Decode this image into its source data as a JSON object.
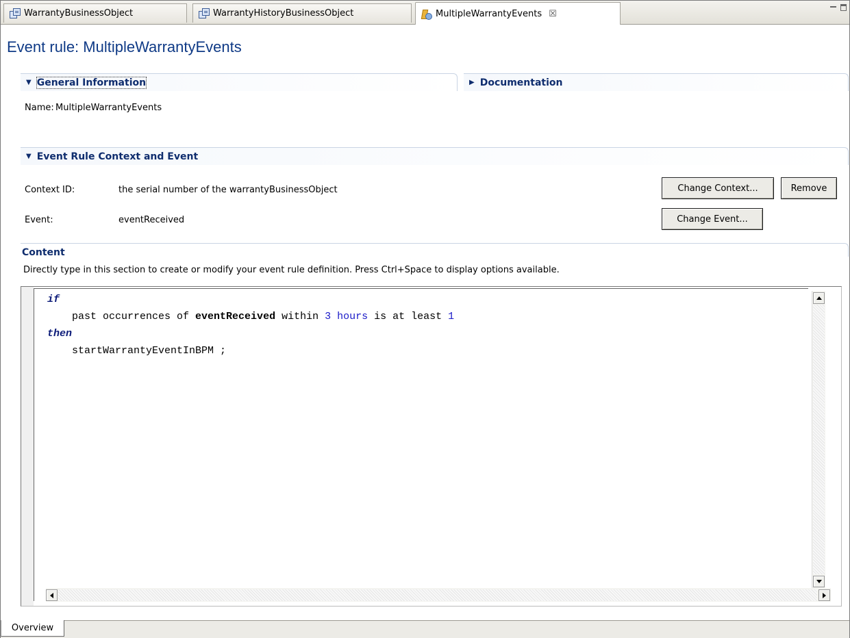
{
  "tabs": [
    {
      "label": "WarrantyBusinessObject",
      "icon": "business-object-icon"
    },
    {
      "label": "WarrantyHistoryBusinessObject",
      "icon": "business-object-icon"
    },
    {
      "label": "MultipleWarrantyEvents",
      "icon": "event-rule-icon",
      "active": true,
      "close": "☒"
    }
  ],
  "editor": {
    "title": "Event rule: MultipleWarrantyEvents"
  },
  "general_info": {
    "header": "General Information",
    "name_label": "Name:",
    "name_value": "MultipleWarrantyEvents"
  },
  "documentation": {
    "header": "Documentation"
  },
  "context_section": {
    "header": "Event Rule Context and Event",
    "context_label": "Context ID:",
    "context_value": "the serial number of the warrantyBusinessObject",
    "event_label": "Event:",
    "event_value": "eventReceived",
    "change_context_button": "Change Context...",
    "remove_button": "Remove",
    "change_event_button": "Change Event..."
  },
  "content": {
    "header": "Content",
    "description": "Directly type in this section to create or modify your event rule definition. Press Ctrl+Space to display options available.",
    "code": {
      "kw_if": "if",
      "line2_a": "past occurrences of ",
      "line2_event": "eventReceived",
      "line2_b": " within ",
      "line2_num": "3",
      "line2_unit": "hours",
      "line2_c": " is at least ",
      "line2_count": "1",
      "kw_then": "then",
      "line4": "startWarrantyEventInBPM ;"
    }
  },
  "bottom_tabs": {
    "overview": "Overview"
  }
}
